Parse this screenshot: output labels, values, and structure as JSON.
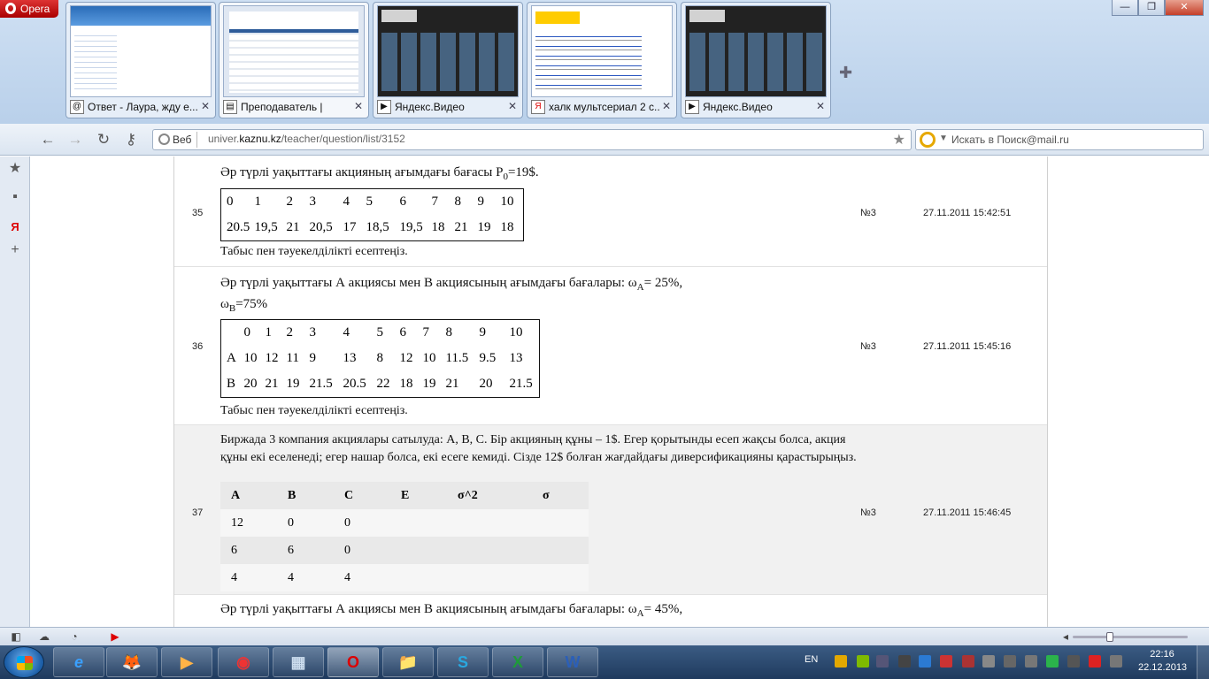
{
  "browser": {
    "menu_label": "Opera",
    "tabs": [
      {
        "title": "Ответ - Лаура, жду е...",
        "favicon": "@"
      },
      {
        "title": "Преподаватель |",
        "favicon": "▤"
      },
      {
        "title": "Яндекс.Видео",
        "favicon": "▶"
      },
      {
        "title": "халк мультсериал 2 с...",
        "favicon": "Я"
      },
      {
        "title": "Яндекс.Видео",
        "favicon": "▶"
      }
    ],
    "address": {
      "badge": "Веб",
      "url_prefix": "univer.",
      "url_domain": "kaznu.kz",
      "url_path": "/teacher/question/list/3152"
    },
    "search_placeholder": "Искать в Поиск@mail.ru"
  },
  "questions": [
    {
      "num": "35",
      "text": "Әр түрлі уақыттағы акцияның ағымдағы бағасы P",
      "sub": "0",
      "text_after": "=19$.",
      "table": [
        [
          "0",
          "1",
          "2",
          "3",
          "4",
          "5",
          "6",
          "7",
          "8",
          "9",
          "10"
        ],
        [
          "20.5",
          "19,5",
          "21",
          "20,5",
          "17",
          "18,5",
          "19,5",
          "18",
          "21",
          "19",
          "18"
        ]
      ],
      "footer": "Табыс пен тәуекелділікті есептеңіз.",
      "group": "№3",
      "datetime": "27.11.2011 15:42:51"
    },
    {
      "num": "36",
      "text": "Әр түрлі уақыттағы А акциясы мен В акциясының  ағымдағы бағалары: ω",
      "sub": "A",
      "text_after": "= 25%,",
      "line2_pre": "ω",
      "line2_sub": "B",
      "line2_after": "=75%",
      "table": [
        [
          "",
          "0",
          "1",
          "2",
          "3",
          "4",
          "5",
          "6",
          "7",
          "8",
          "9",
          "10"
        ],
        [
          "A",
          "10",
          "12",
          "11",
          "9",
          "13",
          "8",
          "12",
          "10",
          "11.5",
          "9.5",
          "13"
        ],
        [
          "B",
          "20",
          "21",
          "19",
          "21.5",
          "20.5",
          "22",
          "18",
          "19",
          "21",
          "20",
          "21.5"
        ]
      ],
      "footer": "Табыс пен тәуекелділікті есептеңіз.",
      "group": "№3",
      "datetime": "27.11.2011 15:45:16"
    },
    {
      "num": "37",
      "text": "Биржада 3 компания акциялары сатылуда: А, В, С. Бір акцияның құны – 1$. Егер қорытынды есеп жақсы болса, акция құны екі еселенеді; егер нашар болса, екі есеге кемиді. Сізде 12$ болған жағдайдағы диверсификацияны қарастырыңыз.",
      "table": [
        [
          "A",
          "B",
          "C",
          "E",
          "σ^2",
          "σ"
        ],
        [
          "12",
          "0",
          "0",
          "",
          "",
          ""
        ],
        [
          "6",
          "6",
          "0",
          "",
          "",
          ""
        ],
        [
          "4",
          "4",
          "4",
          "",
          "",
          ""
        ]
      ],
      "group": "№3",
      "datetime": "27.11.2011 15:46:45"
    },
    {
      "text": "Әр түрлі уақыттағы А акциясы мен В акциясының  ағымдағы бағалары: ω",
      "sub": "A",
      "text_after": "= 45%,"
    }
  ],
  "taskbar": {
    "lang": "EN",
    "time": "22:16",
    "date": "22.12.2013",
    "apps": [
      "e",
      "🦊",
      "▶",
      "◉",
      "▦",
      "O",
      "📁",
      "S",
      "X",
      "W"
    ]
  }
}
